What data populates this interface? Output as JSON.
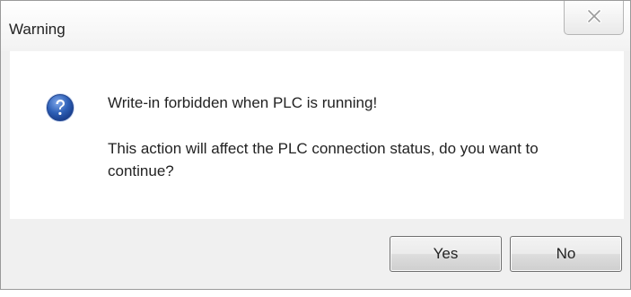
{
  "window": {
    "title": "Warning"
  },
  "dialog": {
    "icon": "question-icon",
    "message": "Write-in forbidden when PLC is running!",
    "detail": "This action will affect the PLC connection status, do you want to continue?"
  },
  "buttons": {
    "yes_label": "Yes",
    "no_label": "No"
  },
  "colors": {
    "icon_blue": "#2d5fb6",
    "body_background": "#ffffff",
    "footer_background": "#f0f0f0"
  }
}
